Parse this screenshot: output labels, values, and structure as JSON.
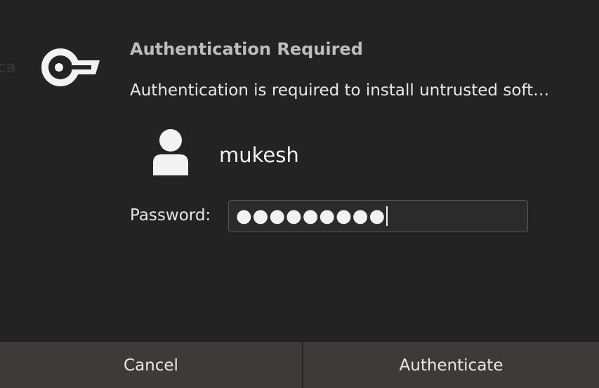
{
  "dialog": {
    "background_fragment": "tica",
    "title": "Authentication Required",
    "message": "Authentication is required to install untrusted soft…",
    "icon": "key-icon",
    "user": {
      "icon": "user-avatar-icon",
      "name": "mukesh"
    },
    "password": {
      "label": "Password:",
      "masked_value": "●●●●●●●●●"
    },
    "buttons": {
      "cancel": "Cancel",
      "authenticate": "Authenticate"
    }
  },
  "colors": {
    "background": "#232323",
    "button": "#3c3b37",
    "field_background": "#2b2b2b",
    "field_border": "#565656",
    "text": "#e6e6e6",
    "title": "#bdbdbd"
  }
}
